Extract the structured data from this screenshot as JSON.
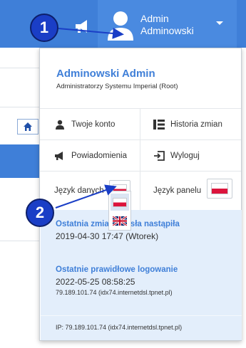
{
  "header": {
    "user_first": "Admin",
    "user_last": "Adminowski",
    "icons": [
      "megaphone-icon",
      "user-icon",
      "caret-down-icon"
    ]
  },
  "dropdown": {
    "name": "Adminowski Admin",
    "role": "Administratorzy Systemu Imperial (Root)",
    "menu": {
      "account": "Twoje konto",
      "history": "Historia zmian",
      "notifications": "Powiadomienia",
      "logout": "Wyloguj",
      "data_language": "Język danych",
      "panel_language": "Język panelu"
    },
    "info": {
      "last_change_label": "Ostatnia zmiana hasła nastąpiła",
      "last_change_value": "2019-04-30 17:47 (Wtorek)",
      "last_login_label": "Ostatnie prawidłowe logowanie",
      "last_login_value": "2022-05-25 08:58:25",
      "last_login_ip": "79.189.101.74 (idx74.internetdsl.tpnet.pl)",
      "current_ip": "IP: 79.189.101.74 (idx74.internetdsl.tpnet.pl)"
    }
  },
  "language_options": [
    "flag-pl",
    "flag-uk"
  ],
  "annotations": {
    "badge1": "1",
    "badge2": "2"
  },
  "colors": {
    "accent": "#3f7fd8",
    "info_bg": "#e3eefb",
    "badge": "#1a3ec6"
  }
}
